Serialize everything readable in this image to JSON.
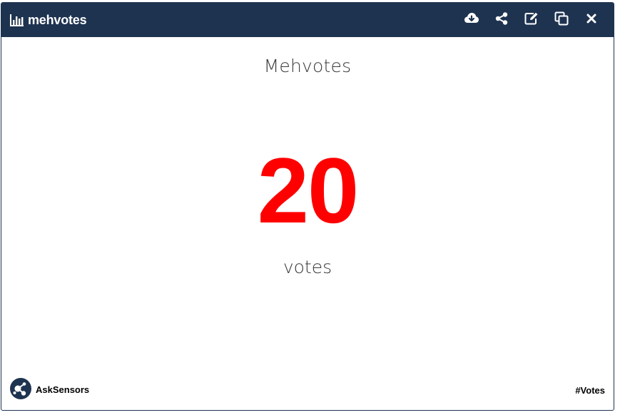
{
  "header": {
    "title": "mehvotes",
    "title_icon": "bar-chart-icon",
    "actions": [
      {
        "icon": "cloud-download-icon"
      },
      {
        "icon": "share-icon"
      },
      {
        "icon": "edit-icon"
      },
      {
        "icon": "duplicate-icon"
      },
      {
        "icon": "close-icon"
      }
    ]
  },
  "content": {
    "title": "Mehvotes",
    "value": "20",
    "unit": "votes"
  },
  "footer": {
    "brand": "AskSensors",
    "brand_icon": "asksensors-logo",
    "tag": "#Votes"
  },
  "colors": {
    "header_bg": "#1e3350",
    "value": "#ff0000",
    "text": "#3a3a3a"
  }
}
